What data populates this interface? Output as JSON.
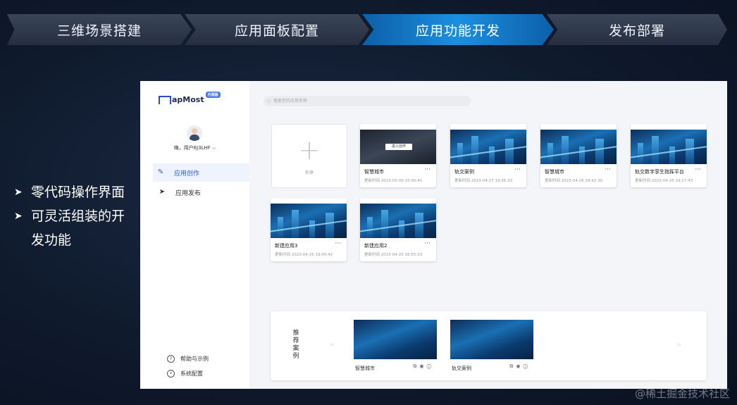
{
  "steps": [
    "三维场景搭建",
    "应用面板配置",
    "应用功能开发",
    "发布部署"
  ],
  "bullets": [
    "零代码操作界面",
    "可灵活组装的开发功能"
  ],
  "app": {
    "logo": "apMost",
    "logo_badge": "内测版",
    "username": "嗨，用户6J3LHF ⌵",
    "nav": [
      {
        "label": "应用创作",
        "icon": "✎"
      },
      {
        "label": "应用发布",
        "icon": "➤"
      }
    ],
    "footer": [
      {
        "label": "帮助与示例"
      },
      {
        "label": "系统配置"
      }
    ],
    "search_placeholder": "搜索您的应用名称",
    "new_label": "新建",
    "enter_label": "进入创作",
    "cards": [
      {
        "title": "智慧城市",
        "time": "更新时间 2023-05-09 15:00:41"
      },
      {
        "title": "轨交案例",
        "time": "更新时间 2023-04-27 19:36:33"
      },
      {
        "title": "智慧城市",
        "time": "更新时间 2023-04-26 18:42:30"
      },
      {
        "title": "轨交数字孪生指挥平台",
        "time": "更新时间 2023-04-25 19:27:43"
      },
      {
        "title": "新建应用3",
        "time": "更新时间 2023-04-25 19:00:42"
      },
      {
        "title": "新建应用2",
        "time": "更新时间 2023-04-25 16:55:33"
      }
    ],
    "recommend_title": "推荐案例",
    "recommend": [
      {
        "name": "智慧城市"
      },
      {
        "name": "轨交案例"
      }
    ]
  },
  "watermark": "@稀土掘金技术社区"
}
